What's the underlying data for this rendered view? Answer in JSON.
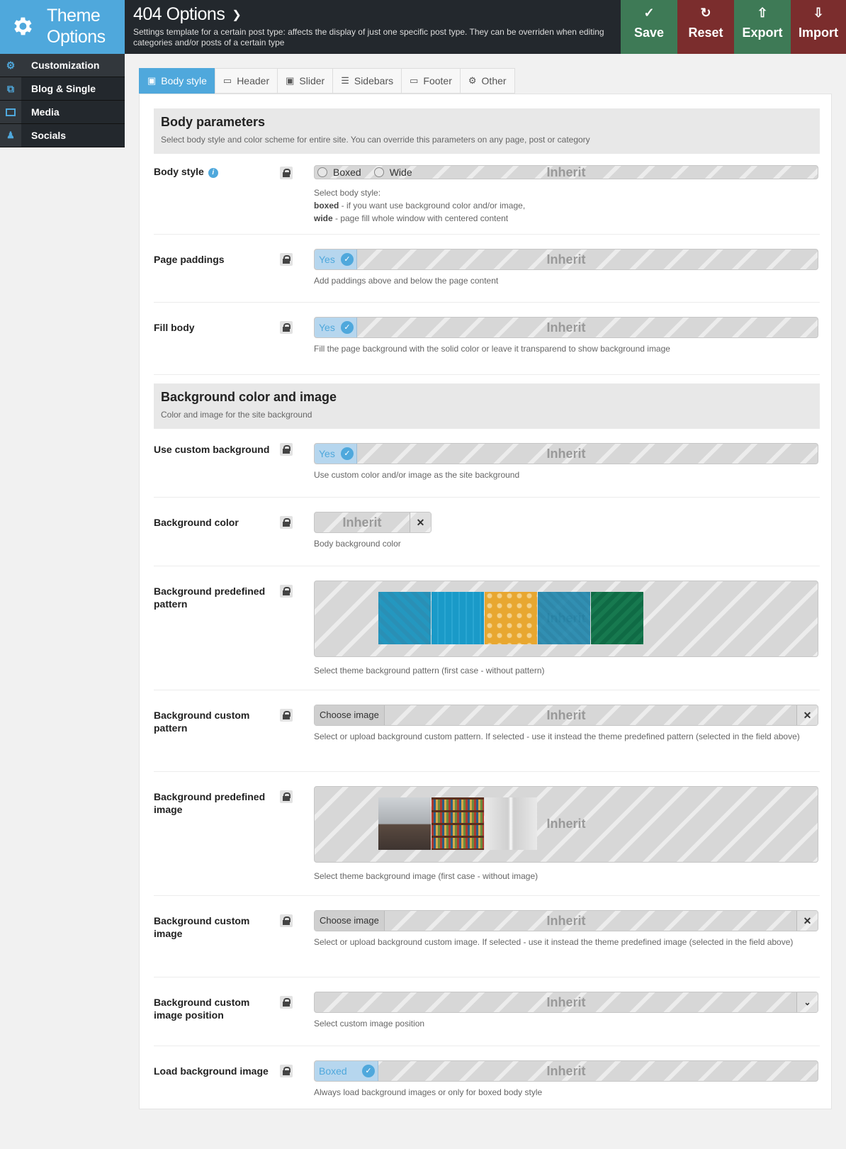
{
  "logo": {
    "line1": "Theme",
    "line2": "Options"
  },
  "header": {
    "title": "404 Options",
    "subtitle": "Settings template for a certain post type: affects the display of just one specific post type. They can be overriden when editing categories and/or posts of a certain type"
  },
  "toolbar": {
    "save": "Save",
    "reset": "Reset",
    "export": "Export",
    "import": "Import"
  },
  "sidebar": {
    "items": [
      {
        "label": "Customization",
        "icon": "gear-icon"
      },
      {
        "label": "Blog & Single",
        "icon": "copy-icon"
      },
      {
        "label": "Media",
        "icon": "image-icon"
      },
      {
        "label": "Socials",
        "icon": "users-icon"
      }
    ]
  },
  "tabs": [
    {
      "label": "Body style",
      "icon": "image-icon",
      "active": true
    },
    {
      "label": "Header",
      "icon": "window-icon"
    },
    {
      "label": "Slider",
      "icon": "image-icon"
    },
    {
      "label": "Sidebars",
      "icon": "list-icon"
    },
    {
      "label": "Footer",
      "icon": "window-icon"
    },
    {
      "label": "Other",
      "icon": "gear-icon"
    }
  ],
  "sections": {
    "body": {
      "title": "Body parameters",
      "desc": "Select body style and color scheme for entire site. You can override this parameters on any page, post or category"
    },
    "bg": {
      "title": "Background color and image",
      "desc": "Color and image for the site background"
    }
  },
  "inherit": "Inherit",
  "fields": {
    "body_style": {
      "label": "Body style",
      "opt1": "Boxed",
      "opt2": "Wide",
      "desc1": "Select body style:",
      "desc2b": "boxed",
      "desc2": " - if you want use background color and/or image,",
      "desc3b": "wide",
      "desc3": " - page fill whole window with centered content"
    },
    "page_paddings": {
      "label": "Page paddings",
      "value": "Yes",
      "desc": "Add paddings above and below the page content"
    },
    "fill_body": {
      "label": "Fill body",
      "value": "Yes",
      "desc": "Fill the page background with the solid color or leave it transparend to show background image"
    },
    "use_custom_bg": {
      "label": "Use custom background",
      "value": "Yes",
      "desc": "Use custom color and/or image as the site background"
    },
    "bg_color": {
      "label": "Background color",
      "desc": "Body background color"
    },
    "bg_pattern": {
      "label": "Background predefined pattern",
      "desc": "Select theme background pattern (first case - without pattern)"
    },
    "bg_custom_pattern": {
      "label": "Background custom pattern",
      "button": "Choose image",
      "desc": "Select or upload background custom pattern. If selected - use it instead the theme predefined pattern (selected in the field above)"
    },
    "bg_image": {
      "label": "Background predefined image",
      "desc": "Select theme background image (first case - without image)"
    },
    "bg_custom_image": {
      "label": "Background custom image",
      "button": "Choose image",
      "desc": "Select or upload background custom image. If selected - use it instead the theme predefined image (selected in the field above)"
    },
    "bg_position": {
      "label": "Background custom image position",
      "desc": "Select custom image position"
    },
    "load_bg": {
      "label": "Load background image",
      "value": "Boxed",
      "desc": "Always load background images or only for boxed body style"
    }
  },
  "colors": {
    "accent": "#4fa8dc",
    "topbar": "#23282d",
    "save": "#3e7a56",
    "reset": "#7b2d2d"
  }
}
